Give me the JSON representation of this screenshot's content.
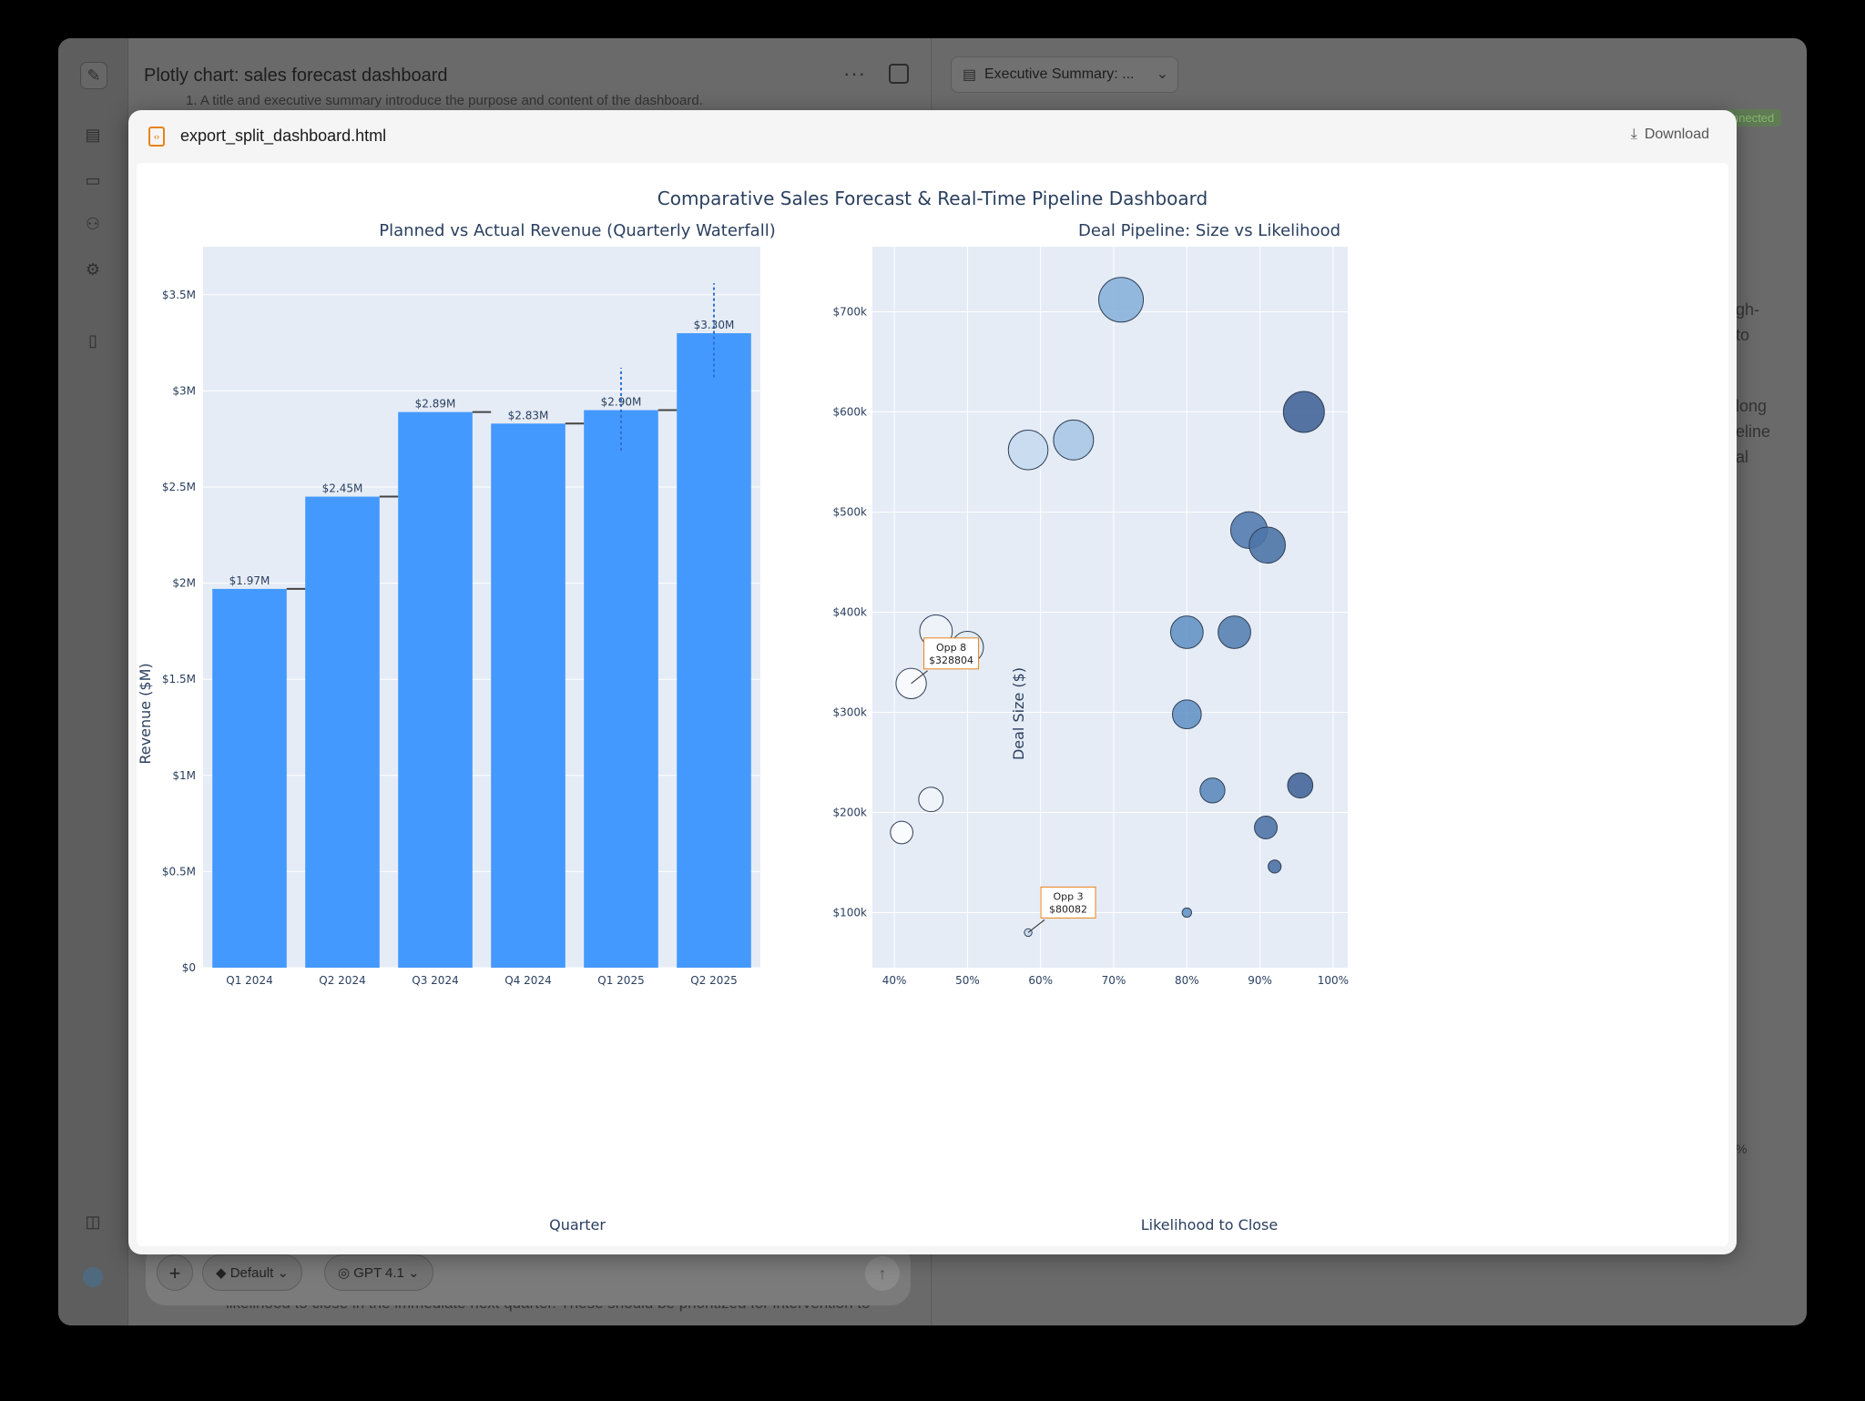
{
  "app": {
    "title": "Plotly chart: sales forecast dashboard",
    "more_icon": "more-horizontal-icon",
    "doc_tab_title": "Executive Summary: ...",
    "status": "nnected",
    "behind_text": {
      "left_line": "1.  A title and executive summary introduce the purpose and content of the dashboard.",
      "right_1a": "gh-",
      "right_1b": "to",
      "right_2a": "long",
      "right_2b": "eline",
      "right_2c": "al",
      "right_3": "%",
      "bottom_line": "likelihood to close in the immediate next quarter. These should be prioritized for intervention to"
    },
    "composer": {
      "mode": "Default",
      "model": "GPT 4.1"
    }
  },
  "modal": {
    "filename": "export_split_dashboard.html",
    "download_label": "Download"
  },
  "chart_data": [
    {
      "type": "bar",
      "title": "Planned vs Actual Revenue (Quarterly Waterfall)",
      "xlabel": "Quarter",
      "ylabel": "Revenue ($M)",
      "categories": [
        "Q1 2024",
        "Q2 2024",
        "Q3 2024",
        "Q4 2024",
        "Q1 2025",
        "Q2 2025"
      ],
      "values": [
        1.97,
        2.45,
        2.89,
        2.83,
        2.9,
        3.3
      ],
      "value_labels": [
        "$1.97M",
        "$2.45M",
        "$2.89M",
        "$2.83M",
        "$2.90M",
        "$3.30M"
      ],
      "error_bars": [
        null,
        null,
        null,
        null,
        [
          2.69,
          3.12
        ],
        [
          3.07,
          3.56
        ]
      ],
      "ylim": [
        0,
        3.75
      ],
      "yticks": [
        0,
        0.5,
        1,
        1.5,
        2,
        2.5,
        3,
        3.5
      ],
      "ytick_labels": [
        "$0",
        "$0.5M",
        "$1M",
        "$1.5M",
        "$2M",
        "$2.5M",
        "$3M",
        "$3.5M"
      ],
      "bar_color": "#4499ff",
      "connector_color": "#444444"
    },
    {
      "type": "scatter",
      "title": "Deal Pipeline: Size vs Likelihood",
      "xlabel": "Likelihood to Close",
      "ylabel": "Deal Size ($)",
      "xlim": [
        0.37,
        1.02
      ],
      "ylim": [
        45000,
        765000
      ],
      "xticks": [
        0.4,
        0.5,
        0.6,
        0.7,
        0.8,
        0.9,
        1.0
      ],
      "xtick_labels": [
        "40%",
        "50%",
        "60%",
        "70%",
        "80%",
        "90%",
        "100%"
      ],
      "yticks": [
        100000,
        200000,
        300000,
        400000,
        500000,
        600000,
        700000
      ],
      "ytick_labels": [
        "$100k",
        "$200k",
        "$300k",
        "$400k",
        "$500k",
        "$600k",
        "$700k"
      ],
      "points": [
        {
          "x": 0.71,
          "y": 712000
        },
        {
          "x": 0.96,
          "y": 600000
        },
        {
          "x": 0.645,
          "y": 572000
        },
        {
          "x": 0.583,
          "y": 562000
        },
        {
          "x": 0.885,
          "y": 482000
        },
        {
          "x": 0.91,
          "y": 467000
        },
        {
          "x": 0.457,
          "y": 381000
        },
        {
          "x": 0.5,
          "y": 365000
        },
        {
          "x": 0.8,
          "y": 380000
        },
        {
          "x": 0.865,
          "y": 380000
        },
        {
          "x": 0.423,
          "y": 328804
        },
        {
          "x": 0.8,
          "y": 298000
        },
        {
          "x": 0.45,
          "y": 213000
        },
        {
          "x": 0.835,
          "y": 222000
        },
        {
          "x": 0.955,
          "y": 227000
        },
        {
          "x": 0.41,
          "y": 180000
        },
        {
          "x": 0.908,
          "y": 185000
        },
        {
          "x": 0.92,
          "y": 146000
        },
        {
          "x": 0.8,
          "y": 100000
        },
        {
          "x": 0.583,
          "y": 80082
        }
      ],
      "annotations": [
        {
          "line1": "Opp 8",
          "line2": "$328804",
          "x": 0.423,
          "y": 328804
        },
        {
          "line1": "Opp 3",
          "line2": "$80082",
          "x": 0.583,
          "y": 80082
        }
      ]
    }
  ],
  "dashboard_title": "Comparative Sales Forecast & Real-Time Pipeline Dashboard"
}
